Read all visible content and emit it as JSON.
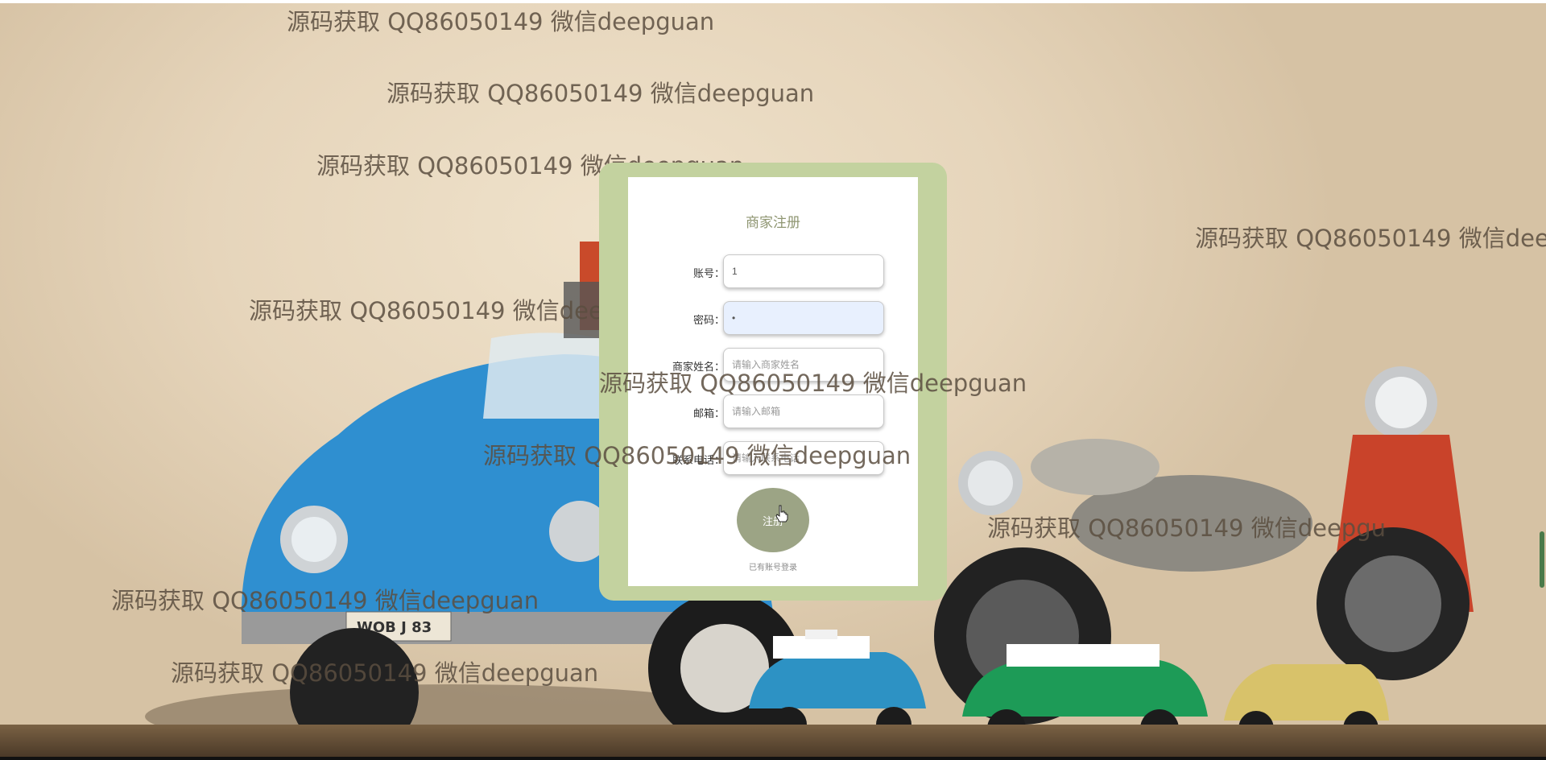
{
  "watermark_text": "源码获取 QQ86050149 微信deepguan",
  "watermark_cut_text": "源码获取 QQ86050149 微信dee",
  "watermark_cut2_text": "源码获取 QQ86050149 微信deepgu",
  "form": {
    "title": "商家注册",
    "fields": [
      {
        "label": "账号：",
        "value": "1",
        "placeholder": ""
      },
      {
        "label": "密码：",
        "value": "•",
        "placeholder": ""
      },
      {
        "label": "商家姓名：",
        "value": "",
        "placeholder": "请输入商家姓名"
      },
      {
        "label": "邮箱：",
        "value": "",
        "placeholder": "请输入邮箱"
      },
      {
        "label": "联系电话：",
        "value": "",
        "placeholder": "请输入联系电话"
      }
    ],
    "submit_label": "注册",
    "login_link": "已有账号登录"
  },
  "colors": {
    "frame": "#c3d29f",
    "button": "#9ca485",
    "title": "#8f9672"
  },
  "icons": [
    "cursor-pointer-icon"
  ]
}
